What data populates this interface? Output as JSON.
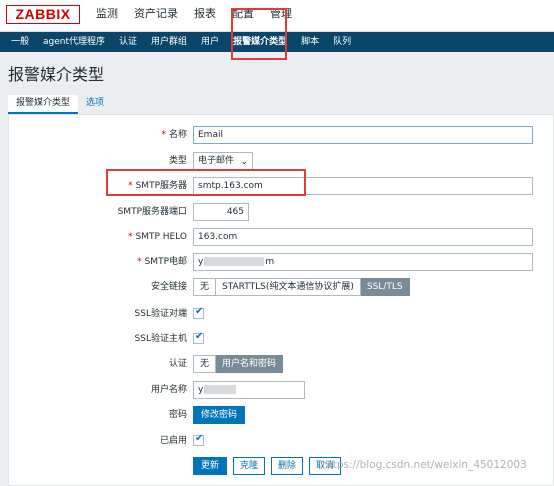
{
  "header": {
    "logo": "ZABBIX",
    "nav": [
      "监测",
      "资产记录",
      "报表",
      "配置",
      "管理"
    ]
  },
  "subnav": [
    "一般",
    "agent代理程序",
    "认证",
    "用户群组",
    "用户",
    "报警媒介类型",
    "脚本",
    "队列"
  ],
  "page_title": "报警媒介类型",
  "tabs": [
    "报警媒介类型",
    "选项"
  ],
  "form": {
    "name_label": "名称",
    "name_value": "Email",
    "type_label": "类型",
    "type_value": "电子邮件",
    "smtp_server_label": "SMTP服务器",
    "smtp_server_value": "smtp.163.com",
    "smtp_port_label": "SMTP服务器端口",
    "smtp_port_value": "465",
    "smtp_helo_label": "SMTP HELO",
    "smtp_helo_value": "163.com",
    "smtp_email_label": "SMTP电邮",
    "smtp_email_prefix": "y",
    "smtp_email_suffix": "m",
    "security_label": "安全链接",
    "security_options": [
      "无",
      "STARTTLS(纯文本通信协议扩展)",
      "SSL/TLS"
    ],
    "ssl_verify_peer_label": "SSL验证对端",
    "ssl_verify_host_label": "SSL验证主机",
    "auth_label": "认证",
    "auth_options": [
      "无",
      "用户名和密码"
    ],
    "username_label": "用户名称",
    "username_prefix": "y",
    "password_label": "密码",
    "change_password_label": "修改密码",
    "enabled_label": "已启用",
    "checkmark": "✔"
  },
  "actions": {
    "update": "更新",
    "clone": "克隆",
    "delete": "删除",
    "cancel": "取消"
  },
  "required_mark": "*",
  "chevron": "⌄",
  "watermark": "https://blog.csdn.net/weixin_45012003",
  "colors": {
    "brand_red": "#d40000",
    "subnav_bg": "#0a466a",
    "primary_blue": "#0275b8",
    "highlight_red": "#e03b3b"
  }
}
